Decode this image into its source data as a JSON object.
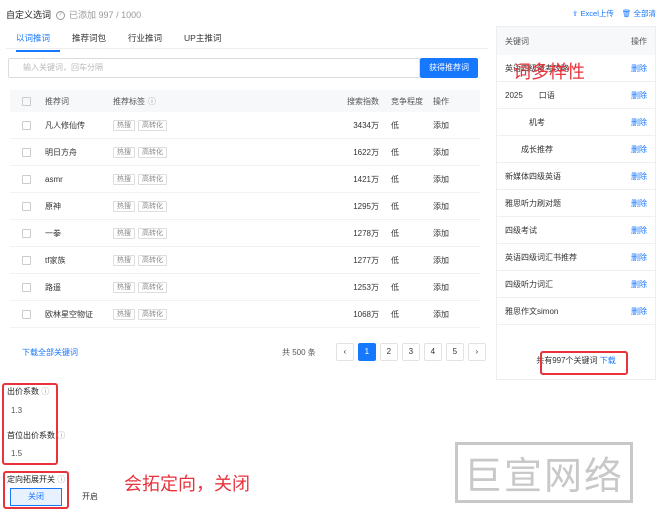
{
  "header": {
    "title": "自定义选词",
    "count_text": "已添加 997 / 1000",
    "excel_upload": "Excel上传",
    "delete_all": "全部清"
  },
  "tabs": [
    {
      "label": "以词推词",
      "active": true
    },
    {
      "label": "推荐词包",
      "active": false
    },
    {
      "label": "行业推词",
      "active": false
    },
    {
      "label": "UP主推词",
      "active": false
    }
  ],
  "search": {
    "placeholder": "输入关键词，回车分隔",
    "button": "获得推荐词"
  },
  "table": {
    "headers": [
      "推荐词",
      "推荐标签",
      "搜索指数",
      "竞争程度",
      "操作"
    ],
    "rows": [
      {
        "keyword": "凡人修仙传",
        "tags": [
          "热搜",
          "高转化"
        ],
        "index": "3434万",
        "competition": "低",
        "action": "添加"
      },
      {
        "keyword": "明日方舟",
        "tags": [
          "热搜",
          "高转化"
        ],
        "index": "1622万",
        "competition": "低",
        "action": "添加"
      },
      {
        "keyword": "asmr",
        "tags": [
          "热搜",
          "高转化"
        ],
        "index": "1421万",
        "competition": "低",
        "action": "添加"
      },
      {
        "keyword": "原神",
        "tags": [
          "热搜",
          "高转化"
        ],
        "index": "1295万",
        "competition": "低",
        "action": "添加"
      },
      {
        "keyword": "一拳",
        "tags": [
          "热搜",
          "高转化"
        ],
        "index": "1278万",
        "competition": "低",
        "action": "添加"
      },
      {
        "keyword": "tf家族",
        "tags": [
          "热搜",
          "高转化"
        ],
        "index": "1277万",
        "competition": "低",
        "action": "添加"
      },
      {
        "keyword": "路遥",
        "tags": [
          "热搜",
          "高转化"
        ],
        "index": "1253万",
        "competition": "低",
        "action": "添加"
      },
      {
        "keyword": "欧林星空物证",
        "tags": [
          "热搜",
          "高转化"
        ],
        "index": "1068万",
        "competition": "低",
        "action": "添加"
      }
    ]
  },
  "download_all": "下载全部关键词",
  "pager": {
    "total": "共 500 条",
    "prev": "‹",
    "pages": [
      "1",
      "2",
      "3",
      "4",
      "5"
    ],
    "next": "›"
  },
  "right_panel": {
    "col_keyword": "关键词",
    "col_op": "操作",
    "rows": [
      {
        "keyword": "英语四级备考攻略",
        "action": "删除"
      },
      {
        "keyword": "2025　　口语",
        "action": "删除"
      },
      {
        "keyword": "　　　机考",
        "action": "删除"
      },
      {
        "keyword": "　　成长推荐",
        "action": "删除"
      },
      {
        "keyword": "新媒体四级英语",
        "action": "删除"
      },
      {
        "keyword": "雅思听力刷对题",
        "action": "删除"
      },
      {
        "keyword": "四级考试",
        "action": "删除"
      },
      {
        "keyword": "英语四级词汇书推荐",
        "action": "删除"
      },
      {
        "keyword": "四级听力词汇",
        "action": "删除"
      },
      {
        "keyword": "雅思作文simon",
        "action": "删除"
      }
    ],
    "footer_text": "共有997个关键词",
    "footer_download": "下载"
  },
  "bid": {
    "coef_label": "出价系数",
    "coef_value": "1.3",
    "first_label": "首位出价系数",
    "first_value": "1.5"
  },
  "targeting": {
    "label": "定向拓展开关",
    "off": "关闭",
    "on": "开启"
  },
  "annotations": {
    "diversity": "词多样性",
    "expand": "会拓定向，关闭"
  },
  "watermark": "巨宣网络",
  "colors": {
    "accent": "#1677ff",
    "annotation": "#e8323c"
  }
}
